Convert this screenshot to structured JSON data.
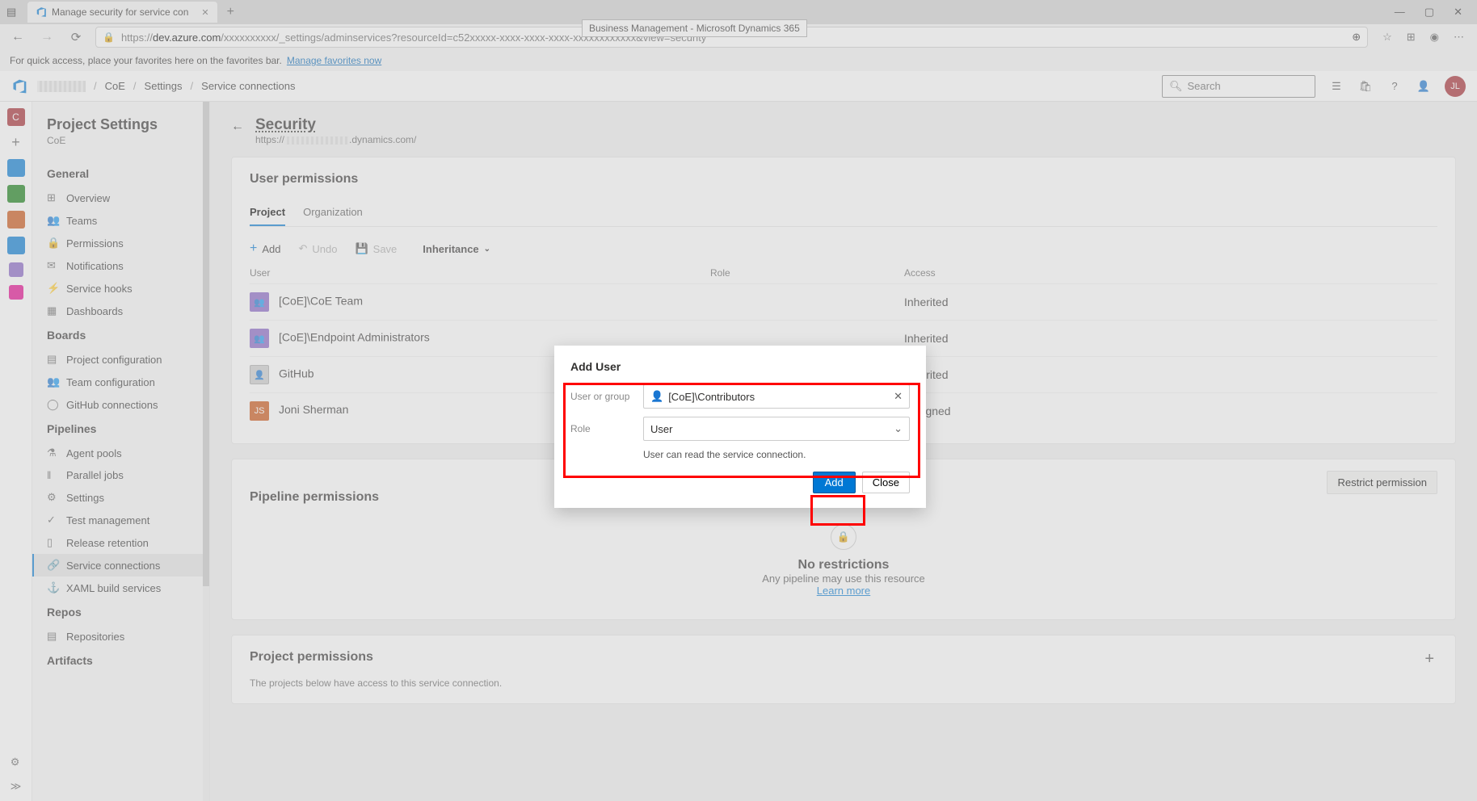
{
  "browser": {
    "tab_title": "Manage security for service con",
    "plus_tab_tooltip": "+",
    "win_min": "—",
    "win_max": "▢",
    "win_close": "✕",
    "back": "←",
    "forward": "→",
    "refresh": "⟳",
    "lock": "🔒",
    "url_prefix": "https://",
    "url_host": "dev.azure.com",
    "url_path": "/xxxxxxxxxx/_settings/adminservices?resourceId=c52xxxxx-xxxx-xxxx-xxxx-xxxxxxxxxxxx&view=security",
    "tooltip": "Business Management - Microsoft Dynamics 365",
    "star": "☆",
    "fav_text": "For quick access, place your favorites here on the favorites bar.",
    "fav_link": "Manage favorites now"
  },
  "topnav": {
    "breadcrumbs": [
      "",
      "CoE",
      "Settings",
      "Service connections"
    ],
    "search_placeholder": "Search",
    "avatar_initials": "JL"
  },
  "rail": {
    "items": [
      {
        "color": "#a4262c",
        "label": "C"
      },
      {
        "color": "#0078d4",
        "label": ""
      },
      {
        "color": "#107c10",
        "label": ""
      },
      {
        "color": "#ca5010",
        "label": ""
      },
      {
        "color": "#0078d4",
        "label": ""
      },
      {
        "color": "#8661c5",
        "label": ""
      },
      {
        "color": "#e3008c",
        "label": ""
      }
    ]
  },
  "sidebar": {
    "title": "Project Settings",
    "subtitle": "CoE",
    "groups": [
      {
        "title": "General",
        "items": [
          "Overview",
          "Teams",
          "Permissions",
          "Notifications",
          "Service hooks",
          "Dashboards"
        ]
      },
      {
        "title": "Boards",
        "items": [
          "Project configuration",
          "Team configuration",
          "GitHub connections"
        ]
      },
      {
        "title": "Pipelines",
        "items": [
          "Agent pools",
          "Parallel jobs",
          "Settings",
          "Test management",
          "Release retention",
          "Service connections",
          "XAML build services"
        ]
      },
      {
        "title": "Repos",
        "items": [
          "Repositories"
        ]
      },
      {
        "title": "Artifacts",
        "items": []
      }
    ],
    "active_item": "Service connections"
  },
  "page": {
    "title": "Security",
    "subtitle_prefix": "https://",
    "subtitle_suffix": ".dynamics.com/"
  },
  "user_permissions": {
    "heading": "User permissions",
    "tabs": [
      "Project",
      "Organization"
    ],
    "active_tab": "Project",
    "toolbar": {
      "add": "Add",
      "undo": "Undo",
      "save": "Save",
      "inherit": "Inheritance"
    },
    "columns": [
      "User",
      "Role",
      "Access"
    ],
    "rows": [
      {
        "icon": "purple",
        "name": "[CoE]\\CoE Team",
        "access": "Inherited"
      },
      {
        "icon": "purple",
        "name": "[CoE]\\Endpoint Administrators",
        "access": "Inherited"
      },
      {
        "icon": "grey",
        "name": "GitHub",
        "access": "Inherited"
      },
      {
        "icon": "orange",
        "name": "Joni Sherman",
        "access": "Assigned"
      }
    ]
  },
  "pipeline_permissions": {
    "heading": "Pipeline permissions",
    "restrict_btn": "Restrict permission",
    "norest_title": "No restrictions",
    "norest_sub": "Any pipeline may use this resource",
    "learn_more": "Learn more"
  },
  "project_permissions": {
    "heading": "Project permissions",
    "sub": "The projects below have access to this service connection."
  },
  "modal": {
    "title": "Add User",
    "user_label": "User or group",
    "user_value": "[CoE]\\Contributors",
    "role_label": "Role",
    "role_value": "User",
    "role_desc": "User can read the service connection.",
    "add_btn": "Add",
    "close_btn": "Close"
  }
}
